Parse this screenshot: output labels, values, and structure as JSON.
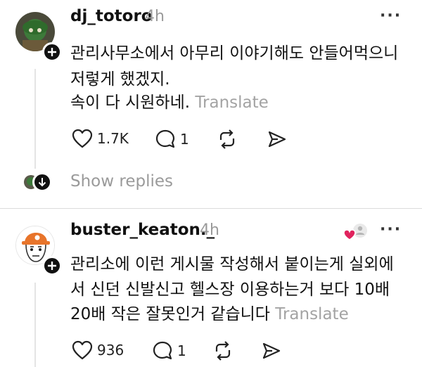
{
  "post1": {
    "username": "dj_totoro",
    "time": "4h",
    "lines": [
      "관리사무소에서 아무리 이야기해도 안들어먹으니",
      "저렇게 했겠지.",
      "속이 다 시원하네."
    ],
    "translate": "Translate",
    "likes": "1.7K",
    "replies": "1",
    "more": "···"
  },
  "show_replies": "Show replies",
  "post2": {
    "username": "buster_keaton._",
    "time": "4h",
    "lines": [
      "관리소에 이런 게시물 작성해서 붙이는게 실외에",
      "서 신던 신발신고 헬스장 이용하는거 보다 10배",
      "20배 작은 잘못인거 같습니다"
    ],
    "translate": "Translate",
    "likes": "936",
    "replies": "1",
    "more": "···"
  },
  "colors": {
    "heart_badge": "#e0245e",
    "muted": "#9a9a9a"
  }
}
